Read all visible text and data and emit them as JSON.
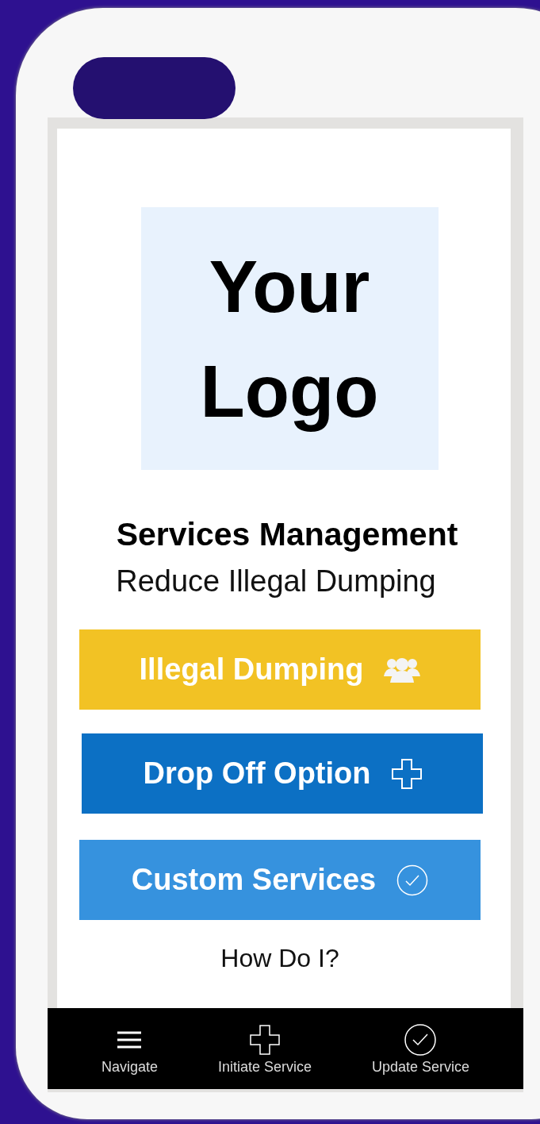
{
  "logo": {
    "lines": [
      "Your",
      "Logo"
    ]
  },
  "title": "Services Management",
  "subtitle": "Reduce Illegal Dumping",
  "buttons": [
    {
      "label": "Illegal Dumping",
      "kind": "people",
      "color": "#f2c224"
    },
    {
      "label": "Drop Off Option",
      "kind": "plus",
      "color": "#0c70c4"
    },
    {
      "label": "Custom Services",
      "kind": "check",
      "color": "#3692de"
    }
  ],
  "help_link": "How Do I?",
  "nav": [
    {
      "label": "Navigate",
      "kind": "menu"
    },
    {
      "label": "Initiate Service",
      "kind": "plus"
    },
    {
      "label": "Update Service",
      "kind": "check"
    }
  ]
}
